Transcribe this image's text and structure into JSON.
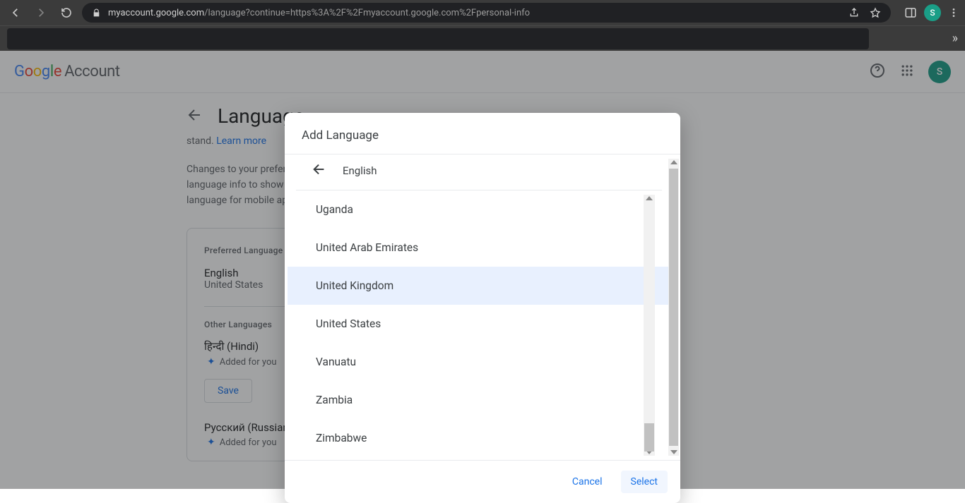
{
  "browser": {
    "url_host": "myaccount.google.com",
    "url_path": "/language?continue=https%3A%2F%2Fmyaccount.google.com%2Fpersonal-info",
    "avatar_letter": "S"
  },
  "header": {
    "logo_word": "Google",
    "logo_suffix": "Account",
    "avatar_letter": "S"
  },
  "main": {
    "title": "Language",
    "para1_tail": "stand. ",
    "learn_more": "Learn more",
    "para2": "Changes to your preferred language are reflected on the web. Apps also use your language info to show you content in your preferred language. To change the preferred language for mobile apps, update the language settings on your device.",
    "card": {
      "preferred_heading": "Preferred Language",
      "preferred_lang": "English",
      "preferred_region": "United States",
      "other_heading": "Other Languages",
      "items": [
        {
          "label": "हिन्दी (Hindi)",
          "added": "Added for you"
        },
        {
          "label": "Русский (Russian)",
          "added": "Added for you"
        }
      ],
      "save": "Save"
    }
  },
  "dialog": {
    "title": "Add Language",
    "parent_lang": "English",
    "options": [
      "Uganda",
      "United Arab Emirates",
      "United Kingdom",
      "United States",
      "Vanuatu",
      "Zambia",
      "Zimbabwe"
    ],
    "selected_index": 2,
    "cancel": "Cancel",
    "select": "Select"
  }
}
